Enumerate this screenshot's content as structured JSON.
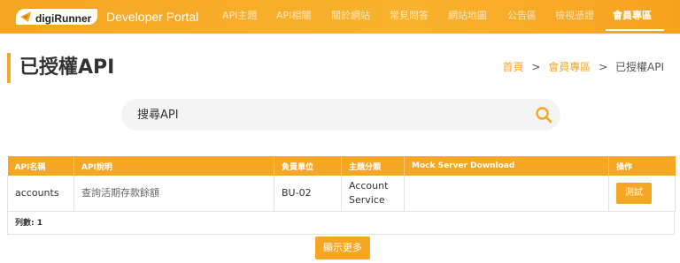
{
  "header": {
    "logo_text": "digiRunner",
    "portal_title": "Developer Portal",
    "nav": [
      "API主題",
      "API相關",
      "關於網站",
      "常見問答",
      "網站地圖",
      "公告區",
      "檢視憑證",
      "會員專區"
    ],
    "active_nav": "會員專區",
    "brand_color": "#f5a623"
  },
  "page": {
    "title": "已授權API",
    "breadcrumb": [
      "首頁",
      "會員專區",
      "已授權API"
    ],
    "breadcrumb_separator": ">"
  },
  "search": {
    "placeholder": "搜尋API",
    "value": "",
    "icon": "search-icon"
  },
  "table": {
    "headers": [
      "API名稱",
      "API說明",
      "負責單位",
      "主題分類",
      "Mock Server Download",
      "操作"
    ],
    "rows": [
      {
        "name": "accounts",
        "desc": "查詢活期存款餘額",
        "unit": "BU-02",
        "category": "Account Service",
        "mock": "",
        "action_label": "測試"
      }
    ],
    "count_label": "列數: 1"
  },
  "more_button": "顯示更多"
}
